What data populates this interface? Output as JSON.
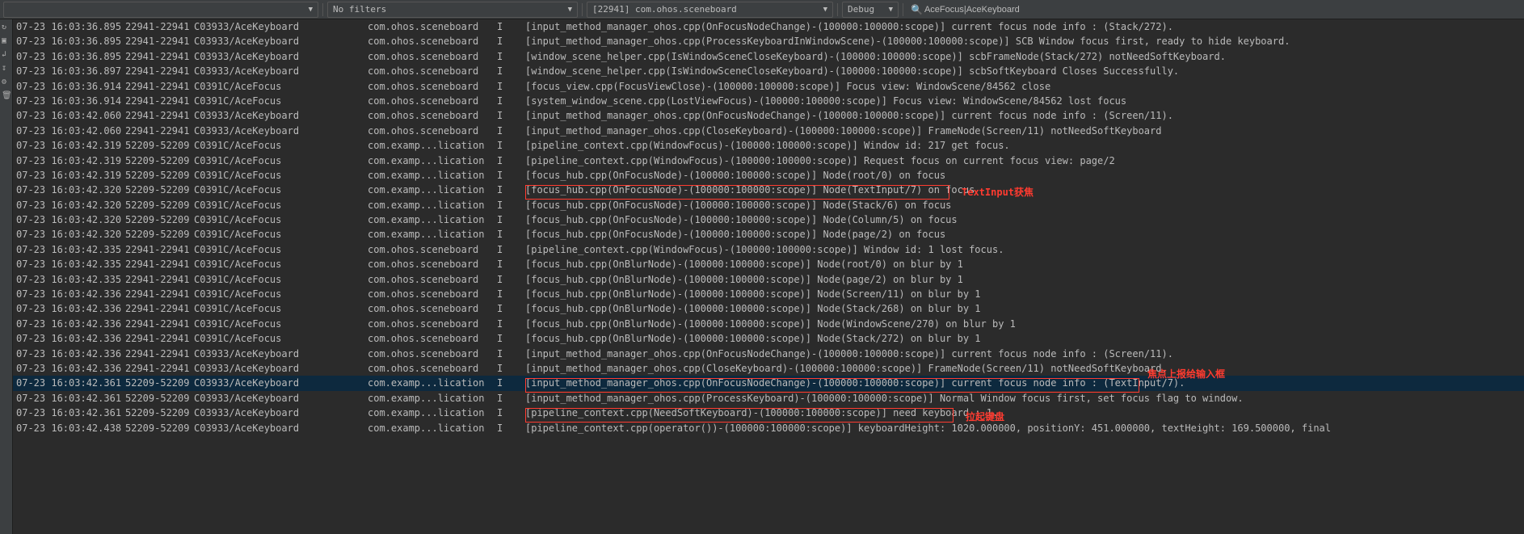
{
  "toolbar": {
    "filters_label": "No filters",
    "package_label": "[22941] com.ohos.sceneboard",
    "level_label": "Debug",
    "search_value": "AceFocus|AceKeyboard"
  },
  "annotations": {
    "a1": "TextInput获焦",
    "a2": "焦点上报给输入框",
    "a3": "拉起键盘"
  },
  "logs": [
    {
      "time": "07-23 16:03:36.895",
      "pid": "22941-22941",
      "tag": "C03933/AceKeyboard",
      "pkg": "com.ohos.sceneboard",
      "lvl": "I",
      "msg": "[input_method_manager_ohos.cpp(OnFocusNodeChange)-(100000:100000:scope)] current focus node info : (Stack/272)."
    },
    {
      "time": "07-23 16:03:36.895",
      "pid": "22941-22941",
      "tag": "C03933/AceKeyboard",
      "pkg": "com.ohos.sceneboard",
      "lvl": "I",
      "msg": "[input_method_manager_ohos.cpp(ProcessKeyboardInWindowScene)-(100000:100000:scope)] SCB Window focus first, ready to hide keyboard."
    },
    {
      "time": "07-23 16:03:36.895",
      "pid": "22941-22941",
      "tag": "C03933/AceKeyboard",
      "pkg": "com.ohos.sceneboard",
      "lvl": "I",
      "msg": "[window_scene_helper.cpp(IsWindowSceneCloseKeyboard)-(100000:100000:scope)] scbFrameNode(Stack/272) notNeedSoftKeyboard."
    },
    {
      "time": "07-23 16:03:36.897",
      "pid": "22941-22941",
      "tag": "C03933/AceKeyboard",
      "pkg": "com.ohos.sceneboard",
      "lvl": "I",
      "msg": "[window_scene_helper.cpp(IsWindowSceneCloseKeyboard)-(100000:100000:scope)] scbSoftKeyboard Closes Successfully."
    },
    {
      "time": "07-23 16:03:36.914",
      "pid": "22941-22941",
      "tag": "C0391C/AceFocus",
      "pkg": "com.ohos.sceneboard",
      "lvl": "I",
      "msg": "[focus_view.cpp(FocusViewClose)-(100000:100000:scope)] Focus view: WindowScene/84562 close"
    },
    {
      "time": "07-23 16:03:36.914",
      "pid": "22941-22941",
      "tag": "C0391C/AceFocus",
      "pkg": "com.ohos.sceneboard",
      "lvl": "I",
      "msg": "[system_window_scene.cpp(LostViewFocus)-(100000:100000:scope)] Focus view: WindowScene/84562 lost focus"
    },
    {
      "time": "07-23 16:03:42.060",
      "pid": "22941-22941",
      "tag": "C03933/AceKeyboard",
      "pkg": "com.ohos.sceneboard",
      "lvl": "I",
      "msg": "[input_method_manager_ohos.cpp(OnFocusNodeChange)-(100000:100000:scope)] current focus node info : (Screen/11)."
    },
    {
      "time": "07-23 16:03:42.060",
      "pid": "22941-22941",
      "tag": "C03933/AceKeyboard",
      "pkg": "com.ohos.sceneboard",
      "lvl": "I",
      "msg": "[input_method_manager_ohos.cpp(CloseKeyboard)-(100000:100000:scope)] FrameNode(Screen/11) notNeedSoftKeyboard"
    },
    {
      "time": "07-23 16:03:42.319",
      "pid": "52209-52209",
      "tag": "C0391C/AceFocus",
      "pkg": "com.examp...lication",
      "lvl": "I",
      "msg": "[pipeline_context.cpp(WindowFocus)-(100000:100000:scope)] Window id: 217 get focus."
    },
    {
      "time": "07-23 16:03:42.319",
      "pid": "52209-52209",
      "tag": "C0391C/AceFocus",
      "pkg": "com.examp...lication",
      "lvl": "I",
      "msg": "[pipeline_context.cpp(WindowFocus)-(100000:100000:scope)] Request focus on current focus view: page/2"
    },
    {
      "time": "07-23 16:03:42.319",
      "pid": "52209-52209",
      "tag": "C0391C/AceFocus",
      "pkg": "com.examp...lication",
      "lvl": "I",
      "msg": "[focus_hub.cpp(OnFocusNode)-(100000:100000:scope)] Node(root/0) on focus"
    },
    {
      "time": "07-23 16:03:42.320",
      "pid": "52209-52209",
      "tag": "C0391C/AceFocus",
      "pkg": "com.examp...lication",
      "lvl": "I",
      "msg": "[focus_hub.cpp(OnFocusNode)-(100000:100000:scope)] Node(TextInput/7) on focus",
      "box": "red"
    },
    {
      "time": "07-23 16:03:42.320",
      "pid": "52209-52209",
      "tag": "C0391C/AceFocus",
      "pkg": "com.examp...lication",
      "lvl": "I",
      "msg": "[focus_hub.cpp(OnFocusNode)-(100000:100000:scope)] Node(Stack/6) on focus"
    },
    {
      "time": "07-23 16:03:42.320",
      "pid": "52209-52209",
      "tag": "C0391C/AceFocus",
      "pkg": "com.examp...lication",
      "lvl": "I",
      "msg": "[focus_hub.cpp(OnFocusNode)-(100000:100000:scope)] Node(Column/5) on focus"
    },
    {
      "time": "07-23 16:03:42.320",
      "pid": "52209-52209",
      "tag": "C0391C/AceFocus",
      "pkg": "com.examp...lication",
      "lvl": "I",
      "msg": "[focus_hub.cpp(OnFocusNode)-(100000:100000:scope)] Node(page/2) on focus"
    },
    {
      "time": "07-23 16:03:42.335",
      "pid": "22941-22941",
      "tag": "C0391C/AceFocus",
      "pkg": "com.ohos.sceneboard",
      "lvl": "I",
      "msg": "[pipeline_context.cpp(WindowFocus)-(100000:100000:scope)] Window id: 1 lost focus."
    },
    {
      "time": "07-23 16:03:42.335",
      "pid": "22941-22941",
      "tag": "C0391C/AceFocus",
      "pkg": "com.ohos.sceneboard",
      "lvl": "I",
      "msg": "[focus_hub.cpp(OnBlurNode)-(100000:100000:scope)] Node(root/0) on blur by 1"
    },
    {
      "time": "07-23 16:03:42.335",
      "pid": "22941-22941",
      "tag": "C0391C/AceFocus",
      "pkg": "com.ohos.sceneboard",
      "lvl": "I",
      "msg": "[focus_hub.cpp(OnBlurNode)-(100000:100000:scope)] Node(page/2) on blur by 1"
    },
    {
      "time": "07-23 16:03:42.336",
      "pid": "22941-22941",
      "tag": "C0391C/AceFocus",
      "pkg": "com.ohos.sceneboard",
      "lvl": "I",
      "msg": "[focus_hub.cpp(OnBlurNode)-(100000:100000:scope)] Node(Screen/11) on blur by 1"
    },
    {
      "time": "07-23 16:03:42.336",
      "pid": "22941-22941",
      "tag": "C0391C/AceFocus",
      "pkg": "com.ohos.sceneboard",
      "lvl": "I",
      "msg": "[focus_hub.cpp(OnBlurNode)-(100000:100000:scope)] Node(Stack/268) on blur by 1"
    },
    {
      "time": "07-23 16:03:42.336",
      "pid": "22941-22941",
      "tag": "C0391C/AceFocus",
      "pkg": "com.ohos.sceneboard",
      "lvl": "I",
      "msg": "[focus_hub.cpp(OnBlurNode)-(100000:100000:scope)] Node(WindowScene/270) on blur by 1"
    },
    {
      "time": "07-23 16:03:42.336",
      "pid": "22941-22941",
      "tag": "C0391C/AceFocus",
      "pkg": "com.ohos.sceneboard",
      "lvl": "I",
      "msg": "[focus_hub.cpp(OnBlurNode)-(100000:100000:scope)] Node(Stack/272) on blur by 1"
    },
    {
      "time": "07-23 16:03:42.336",
      "pid": "22941-22941",
      "tag": "C03933/AceKeyboard",
      "pkg": "com.ohos.sceneboard",
      "lvl": "I",
      "msg": "[input_method_manager_ohos.cpp(OnFocusNodeChange)-(100000:100000:scope)] current focus node info : (Screen/11)."
    },
    {
      "time": "07-23 16:03:42.336",
      "pid": "22941-22941",
      "tag": "C03933/AceKeyboard",
      "pkg": "com.ohos.sceneboard",
      "lvl": "I",
      "msg": "[input_method_manager_ohos.cpp(CloseKeyboard)-(100000:100000:scope)] FrameNode(Screen/11) notNeedSoftKeyboard."
    },
    {
      "time": "07-23 16:03:42.361",
      "pid": "52209-52209",
      "tag": "C03933/AceKeyboard",
      "pkg": "com.examp...lication",
      "lvl": "I",
      "msg": "[input_method_manager_ohos.cpp(OnFocusNodeChange)-(100000:100000:scope)] current focus node info : (TextInput/7).",
      "sel": true,
      "box": "red"
    },
    {
      "time": "07-23 16:03:42.361",
      "pid": "52209-52209",
      "tag": "C03933/AceKeyboard",
      "pkg": "com.examp...lication",
      "lvl": "I",
      "msg": "[input_method_manager_ohos.cpp(ProcessKeyboard)-(100000:100000:scope)] Normal Window focus first, set focus flag to window."
    },
    {
      "time": "07-23 16:03:42.361",
      "pid": "52209-52209",
      "tag": "C03933/AceKeyboard",
      "pkg": "com.examp...lication",
      "lvl": "I",
      "msg": "[pipeline_context.cpp(NeedSoftKeyboard)-(100000:100000:scope)] need keyboard : 1.",
      "box": "red"
    },
    {
      "time": "07-23 16:03:42.438",
      "pid": "52209-52209",
      "tag": "C03933/AceKeyboard",
      "pkg": "com.examp...lication",
      "lvl": "I",
      "msg": "[pipeline_context.cpp(operator())-(100000:100000:scope)] keyboardHeight: 1020.000000, positionY: 451.000000, textHeight: 169.500000, final"
    }
  ]
}
